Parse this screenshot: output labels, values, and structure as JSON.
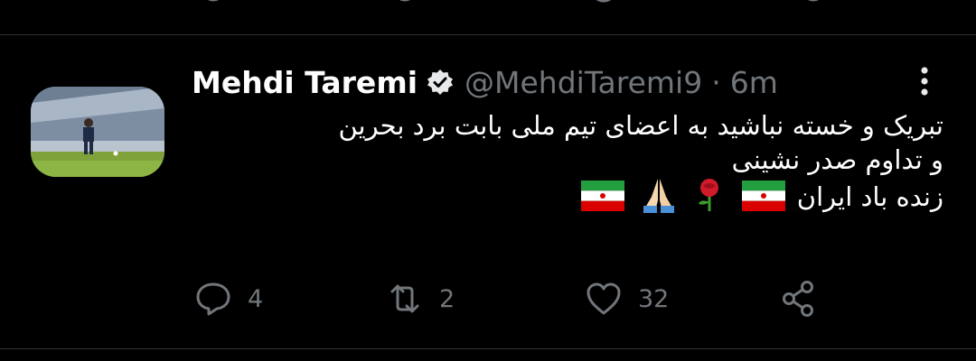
{
  "tweet": {
    "author_name": "Mehdi Taremi",
    "handle": "@MehdiTaremi9",
    "separator": "·",
    "time": "6m",
    "lines": [
      "تبریک و خسته نباشید به اعضای تیم ملی بابت برد بحرین",
      "و تداوم صدر نشینی",
      "زنده باد ایران"
    ],
    "reply_count": "4",
    "retweet_count": "2",
    "like_count": "32"
  },
  "icons": {
    "verified": "verified-badge-icon",
    "more": "more-vertical-icon",
    "reply": "reply-icon",
    "retweet": "retweet-icon",
    "like": "heart-icon",
    "share": "share-icon",
    "emoji_sequence": [
      "iran-flag",
      "rose",
      "folded-hands",
      "iran-flag"
    ]
  },
  "colors": {
    "background": "#000000",
    "text": "#ffffff",
    "secondary_text": "#71767b",
    "divider": "#2f3336",
    "flag_green": "#239f40",
    "flag_red": "#da0000"
  }
}
